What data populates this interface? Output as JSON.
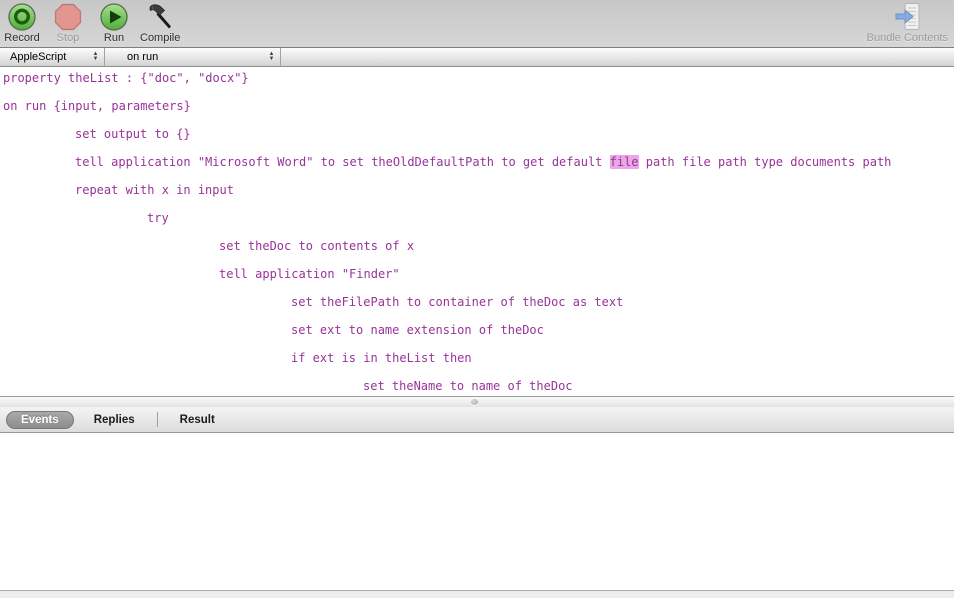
{
  "toolbar": {
    "buttons": [
      {
        "label": "Record",
        "icon": "record-icon",
        "disabled": false
      },
      {
        "label": "Stop",
        "icon": "stop-icon",
        "disabled": true
      },
      {
        "label": "Run",
        "icon": "run-icon",
        "disabled": false
      },
      {
        "label": "Compile",
        "icon": "compile-icon",
        "disabled": false
      }
    ],
    "bundle_contents_label": "Bundle Contents"
  },
  "navbar": {
    "language_selector": "AppleScript",
    "handler_selector": "on run"
  },
  "code": {
    "text_color": "#993399",
    "highlight_color": "#EBA6E8",
    "lines": [
      {
        "indent": 0,
        "pre": "property theList : {\"doc\", \"docx\"}",
        "hl": "",
        "post": ""
      },
      {
        "indent": 0,
        "pre": "",
        "hl": "",
        "post": ""
      },
      {
        "indent": 0,
        "pre": "on run {input, parameters}",
        "hl": "",
        "post": ""
      },
      {
        "indent": 0,
        "pre": "",
        "hl": "",
        "post": ""
      },
      {
        "indent": 1,
        "pre": "set output to {}",
        "hl": "",
        "post": ""
      },
      {
        "indent": 0,
        "pre": "",
        "hl": "",
        "post": ""
      },
      {
        "indent": 1,
        "pre": "tell application \"Microsoft Word\" to set theOldDefaultPath to get default ",
        "hl": "file",
        "post": " path file path type documents path"
      },
      {
        "indent": 0,
        "pre": "",
        "hl": "",
        "post": ""
      },
      {
        "indent": 1,
        "pre": "repeat with x in input",
        "hl": "",
        "post": ""
      },
      {
        "indent": 0,
        "pre": "",
        "hl": "",
        "post": ""
      },
      {
        "indent": 2,
        "pre": "try",
        "hl": "",
        "post": ""
      },
      {
        "indent": 0,
        "pre": "",
        "hl": "",
        "post": ""
      },
      {
        "indent": 3,
        "pre": "set theDoc to contents of x",
        "hl": "",
        "post": ""
      },
      {
        "indent": 0,
        "pre": "",
        "hl": "",
        "post": ""
      },
      {
        "indent": 3,
        "pre": "tell application \"Finder\"",
        "hl": "",
        "post": ""
      },
      {
        "indent": 0,
        "pre": "",
        "hl": "",
        "post": ""
      },
      {
        "indent": 4,
        "pre": "set theFilePath to container of theDoc as text",
        "hl": "",
        "post": ""
      },
      {
        "indent": 0,
        "pre": "",
        "hl": "",
        "post": ""
      },
      {
        "indent": 4,
        "pre": "set ext to name extension of theDoc",
        "hl": "",
        "post": ""
      },
      {
        "indent": 0,
        "pre": "",
        "hl": "",
        "post": ""
      },
      {
        "indent": 4,
        "pre": "if ext is in theList then",
        "hl": "",
        "post": ""
      },
      {
        "indent": 0,
        "pre": "",
        "hl": "",
        "post": ""
      },
      {
        "indent": 5,
        "pre": "set theName to name of theDoc",
        "hl": "",
        "post": ""
      }
    ]
  },
  "tabs": [
    {
      "label": "Events",
      "selected": true
    },
    {
      "label": "Replies",
      "selected": false
    },
    {
      "label": "Result",
      "selected": false
    }
  ],
  "colors": {
    "accent_green": "#5cb648",
    "stop_red": "#e19089",
    "bundle_arrow_blue": "#7aa8e0"
  }
}
